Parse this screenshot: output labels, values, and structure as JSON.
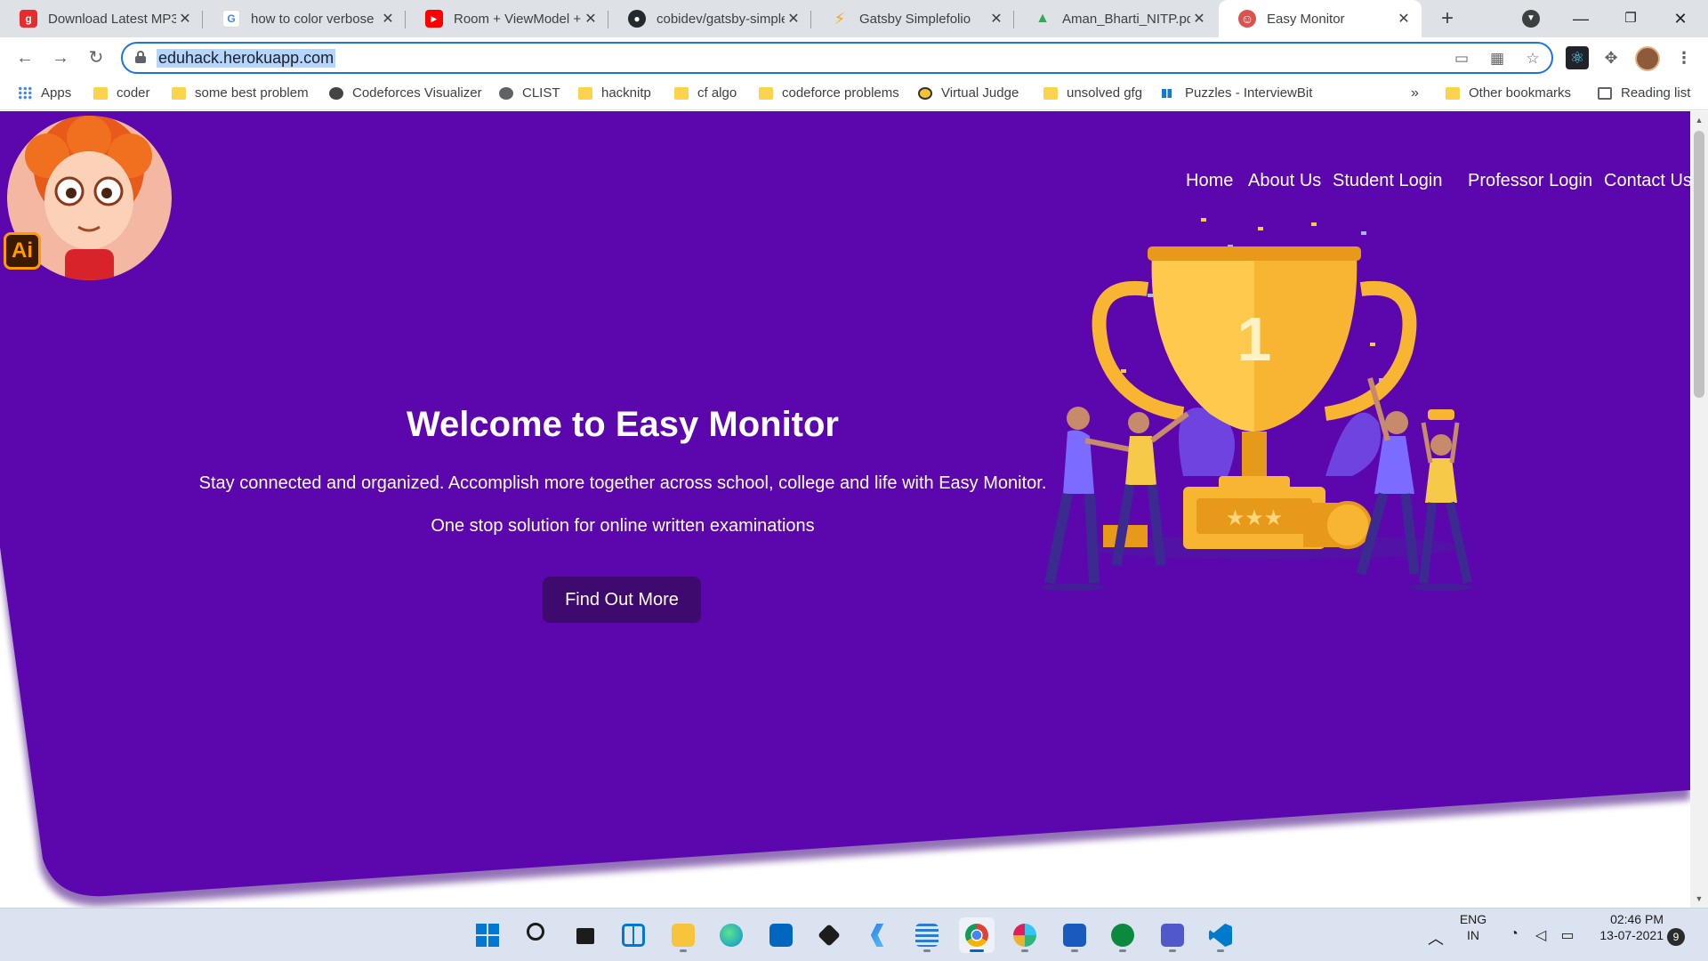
{
  "browser": {
    "tabs": [
      {
        "title": "Download Latest MP3",
        "favicon": "gaana-icon",
        "color": "#e72c30",
        "glyph": "g"
      },
      {
        "title": "how to color verbose",
        "favicon": "google-icon",
        "color": "#4285f4",
        "glyph": "G"
      },
      {
        "title": "Room + ViewModel +",
        "favicon": "youtube-icon",
        "color": "#ff0000",
        "glyph": "▶"
      },
      {
        "title": "cobidev/gatsby-simple",
        "favicon": "github-icon",
        "color": "#24292e",
        "glyph": "●"
      },
      {
        "title": "Gatsby Simplefolio",
        "favicon": "lightning-icon",
        "color": "#f5a623",
        "glyph": "⚡"
      },
      {
        "title": "Aman_Bharti_NITP.pdf",
        "favicon": "google-drive-icon",
        "color": "#34a853",
        "glyph": "▲"
      },
      {
        "title": "Easy Monitor",
        "favicon": "easy-monitor-icon",
        "color": "#d9534f",
        "glyph": "☺",
        "active": true
      }
    ],
    "url": "eduhack.herokuapp.com",
    "bookmarks": [
      {
        "label": "Apps",
        "icon": "apps-grid-icon"
      },
      {
        "label": "coder",
        "icon": "folder-icon"
      },
      {
        "label": "some best problem",
        "icon": "folder-icon"
      },
      {
        "label": "Codeforces Visualizer",
        "icon": "codeforces-icon"
      },
      {
        "label": "CLIST",
        "icon": "globe-icon"
      },
      {
        "label": "hacknitp",
        "icon": "folder-icon"
      },
      {
        "label": "cf algo",
        "icon": "folder-icon"
      },
      {
        "label": "codeforce problems",
        "icon": "folder-icon"
      },
      {
        "label": "Virtual Judge",
        "icon": "vjudge-icon"
      },
      {
        "label": "unsolved gfg",
        "icon": "folder-icon"
      },
      {
        "label": "Puzzles - InterviewBit",
        "icon": "interviewbit-icon"
      }
    ],
    "overflow_label": "»",
    "other_bookmarks": "Other bookmarks",
    "reading_list": "Reading list"
  },
  "page": {
    "nav": [
      "Home",
      "About Us",
      "Student Login",
      "Professor Login",
      "Contact Us"
    ],
    "hero_title": "Welcome to Easy Monitor",
    "hero_text1": "Stay connected and organized. Accomplish more together across school, college and life with Easy Monitor.",
    "hero_text2": "One stop solution for online written examinations",
    "cta_label": "Find Out More",
    "trophy_number": "1",
    "ai_badge": "Ai",
    "colors": {
      "hero": "#5c06ae",
      "cta": "#3f0a6d",
      "trophy": "#f7b531"
    }
  },
  "taskbar": {
    "apps": [
      "start-icon",
      "search-icon",
      "task-view-icon",
      "widgets-icon",
      "file-explorer-icon",
      "edge-icon",
      "store-icon",
      "dropbox-icon",
      "vs-ide-icon",
      "notepad-icon",
      "chrome-icon",
      "slack-icon",
      "word-icon",
      "network-app-icon",
      "teams-icon",
      "vscode-icon"
    ],
    "lang_line1": "ENG",
    "lang_line2": "IN",
    "time": "02:46 PM",
    "date": "13-07-2021",
    "notifications": "9"
  }
}
